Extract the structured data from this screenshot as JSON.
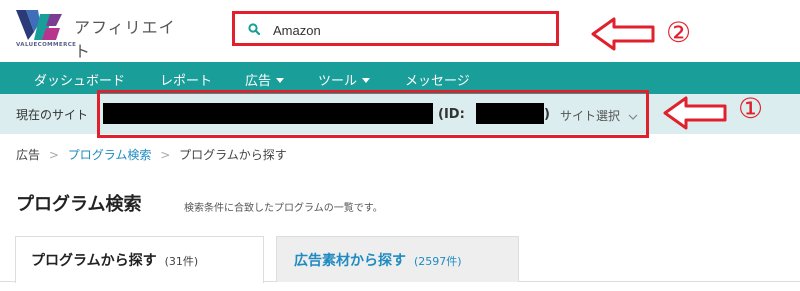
{
  "header": {
    "logo_sub": "VALUECOMMERCE",
    "app_title": "アフィリエイト",
    "search_value": "Amazon"
  },
  "annotations": {
    "marker_1": "①",
    "marker_2": "②",
    "highlight_color": "#e0202c"
  },
  "nav": {
    "items": [
      {
        "label": "ダッシュボード"
      },
      {
        "label": "レポート"
      },
      {
        "label": "広告"
      },
      {
        "label": "ツール"
      },
      {
        "label": "メッセージ"
      }
    ],
    "color": "#1a9e99"
  },
  "sitebar": {
    "label": "現在のサイト",
    "id_label": "(ID:",
    "id_close": ")",
    "select_label": "サイト選択"
  },
  "breadcrumb": {
    "root": "広告",
    "parent": "プログラム検索",
    "current": "プログラムから探す"
  },
  "page": {
    "title": "プログラム検索",
    "description": "検索条件に合致したプログラムの一覧です。"
  },
  "tabs": [
    {
      "label": "プログラムから探す",
      "count": "(31件)"
    },
    {
      "label": "広告素材から探す",
      "count": "(2597件)"
    }
  ]
}
